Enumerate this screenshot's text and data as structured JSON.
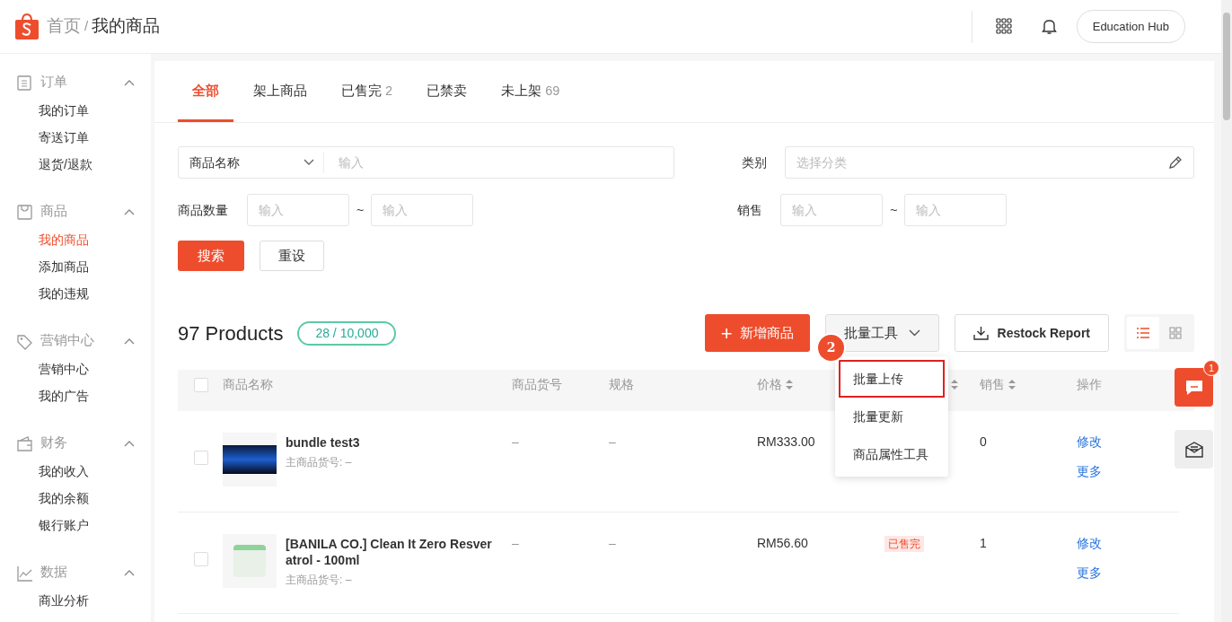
{
  "header": {
    "breadcrumb": [
      {
        "text": "首页",
        "current": false
      },
      {
        "text": "我的商品",
        "current": true
      }
    ],
    "separator": "/",
    "account_button": "Education Hub"
  },
  "sidebar": {
    "sections": [
      {
        "label": "订单",
        "expanded": true,
        "items": [
          {
            "label": "我的订单",
            "selected": false
          },
          {
            "label": "寄送订单",
            "selected": false
          },
          {
            "label": "退货/退款",
            "selected": false
          }
        ]
      },
      {
        "label": "商品",
        "expanded": true,
        "items": [
          {
            "label": "我的商品",
            "selected": true
          },
          {
            "label": "添加商品",
            "selected": false
          },
          {
            "label": "我的违规",
            "selected": false
          }
        ]
      },
      {
        "label": "营销中心",
        "expanded": true,
        "items": [
          {
            "label": "营销中心",
            "selected": false
          },
          {
            "label": "我的广告",
            "selected": false
          }
        ]
      },
      {
        "label": "财务",
        "expanded": true,
        "items": [
          {
            "label": "我的收入",
            "selected": false
          },
          {
            "label": "我的余额",
            "selected": false
          },
          {
            "label": "银行账户",
            "selected": false
          }
        ]
      },
      {
        "label": "数据",
        "expanded": true,
        "items": [
          {
            "label": "商业分析",
            "selected": false
          }
        ]
      }
    ]
  },
  "tabs": [
    {
      "label": "全部",
      "selected": true
    },
    {
      "label": "架上商品",
      "selected": false
    },
    {
      "label": "已售完",
      "count": "2",
      "selected": false
    },
    {
      "label": "已禁卖",
      "selected": false
    },
    {
      "label": "未上架",
      "count": "69",
      "selected": false
    }
  ],
  "filters": {
    "name_select": "商品名称",
    "name_placeholder": "输入",
    "category_label": "类别",
    "category_placeholder": "选择分类",
    "quantity_label": "商品数量",
    "quantity_min_placeholder": "输入",
    "quantity_max_placeholder": "输入",
    "sales_label": "销售",
    "sales_min_placeholder": "输入",
    "sales_max_placeholder": "输入",
    "range_separator": "~",
    "search_button": "搜索",
    "reset_button": "重设"
  },
  "products": {
    "title": "97 Products",
    "quota": "28 / 10,000",
    "add_button": "新增商品",
    "add_button_icon": "+",
    "bulk_button": "批量工具",
    "restock_button": "Restock Report",
    "view_toggles": [
      {
        "selected": true
      },
      {
        "selected": false
      }
    ]
  },
  "bulk_menu": {
    "step_badge": "2",
    "items": [
      {
        "label": "批量上传",
        "highlighted": true
      },
      {
        "label": "批量更新",
        "highlighted": false
      },
      {
        "label": "商品属性工具",
        "highlighted": false
      }
    ]
  },
  "table": {
    "select_all_checked": false,
    "columns": [
      {
        "label": "商品名称",
        "sortable": false
      },
      {
        "label": "商品货号",
        "sortable": false
      },
      {
        "label": "规格",
        "sortable": false
      },
      {
        "label": "价格",
        "sortable": true
      },
      {
        "sortable": true
      },
      {
        "label": "销售",
        "sortable": true
      },
      {
        "label": "操作",
        "sortable": false
      }
    ],
    "rows": [
      {
        "checked": false,
        "name": "bundle test3",
        "parent_sku": "主商品货号: –",
        "sku": "–",
        "variation": "–",
        "price": "RM333.00",
        "sales": "0",
        "actions": [
          "修改",
          "更多"
        ]
      },
      {
        "checked": false,
        "name": "[BANILA CO.] Clean It Zero Resver atrol - 100ml",
        "parent_sku": "主商品货号: –",
        "sku": "–",
        "variation": "–",
        "price": "RM56.60",
        "status": "已售完",
        "sales": "1",
        "actions": [
          "修改",
          "更多"
        ]
      }
    ]
  },
  "floating": {
    "chat_badge": "1"
  }
}
